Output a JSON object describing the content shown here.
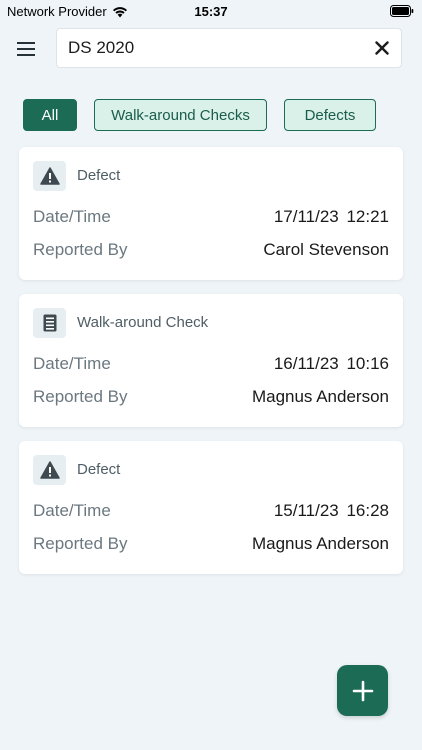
{
  "status_bar": {
    "carrier": "Network Provider",
    "time": "15:37"
  },
  "search": {
    "value": "DS 2020"
  },
  "filters": [
    {
      "label": "All",
      "selected": true
    },
    {
      "label": "Walk-around Checks",
      "selected": false
    },
    {
      "label": "Defects",
      "selected": false
    }
  ],
  "records": [
    {
      "type": "Defect",
      "icon": "warning-icon",
      "date_label": "Date/Time",
      "date_value": "17/11/23 12:21",
      "reporter_label": "Reported By",
      "reporter_value": "Carol Stevenson"
    },
    {
      "type": "Walk-around Check",
      "icon": "checklist-icon",
      "date_label": "Date/Time",
      "date_value": "16/11/23 10:16",
      "reporter_label": "Reported By",
      "reporter_value": "Magnus Anderson"
    },
    {
      "type": "Defect",
      "icon": "warning-icon",
      "date_label": "Date/Time",
      "date_value": "15/11/23 16:28",
      "reporter_label": "Reported By",
      "reporter_value": "Magnus Anderson"
    }
  ],
  "colors": {
    "accent": "#1b6b55",
    "chip_bg": "#d9f1e8",
    "background": "#eef4f7"
  }
}
